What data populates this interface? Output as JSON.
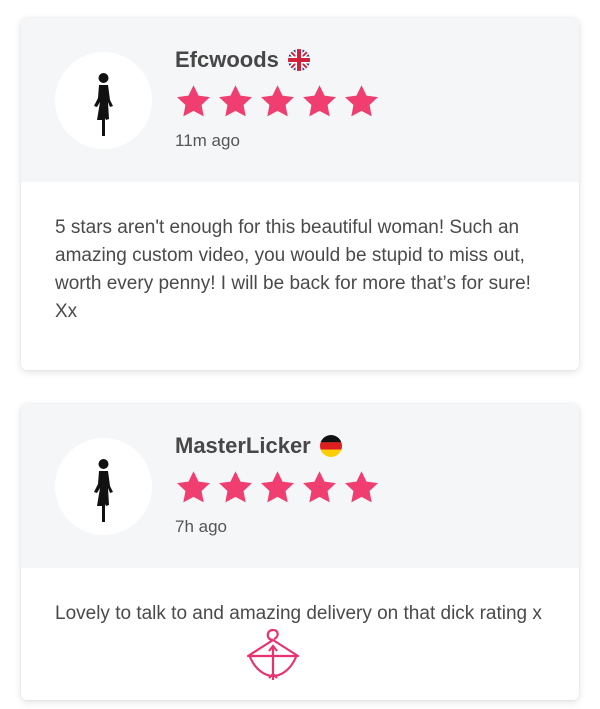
{
  "reviews": [
    {
      "reviewer": "Efcwoods",
      "country_flag_icon": "uk-flag-icon",
      "rating": 5,
      "time_ago": "11m ago",
      "text": "5 stars aren't enough for this beautiful woman! Such an amazing custom video, you would be stupid to miss out, worth every penny! I will be back for more that’s for sure! Xx"
    },
    {
      "reviewer": "MasterLicker",
      "country_flag_icon": "germany-flag-icon",
      "rating": 5,
      "time_ago": "7h ago",
      "text": "Lovely to talk to and amazing delivery on that dick rating x"
    }
  ],
  "colors": {
    "star": "#ef3e6f",
    "header_bg": "#f5f6f8",
    "logo": "#e8336f"
  },
  "icons": {
    "avatar": "woman-silhouette-icon",
    "logo": "hanger-bow-logo-icon"
  }
}
